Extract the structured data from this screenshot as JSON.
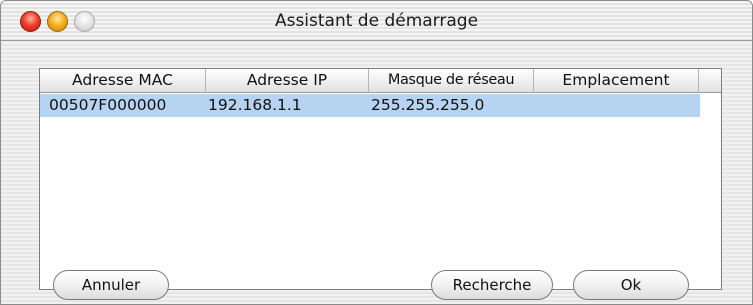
{
  "window": {
    "title": "Assistant de démarrage"
  },
  "table": {
    "columns": [
      "Adresse MAC",
      "Adresse IP",
      "Masque de réseau",
      "Emplacement"
    ],
    "rows": [
      {
        "mac": "00507F000000",
        "ip": "192.168.1.1",
        "mask": "255.255.255.0",
        "location": ""
      }
    ],
    "selected_row_color": "#b7d3f2"
  },
  "buttons": {
    "cancel": "Annuler",
    "search": "Recherche",
    "ok": "Ok"
  },
  "icons": {
    "close": "close-icon",
    "minimize": "minimize-icon",
    "zoom": "zoom-icon"
  }
}
